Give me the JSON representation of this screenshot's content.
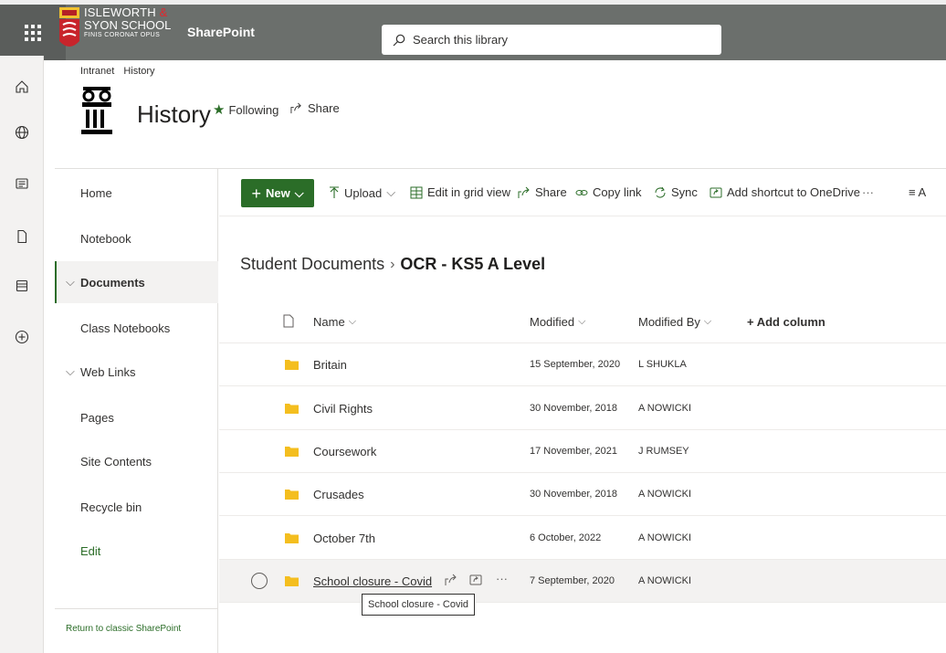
{
  "suitebar": {
    "school_line1": "ISLEWORTH",
    "school_amp": "&",
    "school_line2": "SYON SCHOOL",
    "school_motto": "FINIS CORONAT OPUS",
    "brand": "SharePoint",
    "search_placeholder": "Search this library",
    "bg_color": "#6b6f6c"
  },
  "site": {
    "breadcrumb": [
      "Intranet",
      "History"
    ],
    "title": "History",
    "following_label": "Following",
    "share_label": "Share"
  },
  "leftnav": {
    "items": [
      {
        "label": "Home"
      },
      {
        "label": "Notebook"
      },
      {
        "label": "Documents"
      },
      {
        "label": "Class Notebooks"
      },
      {
        "label": "Web Links"
      },
      {
        "label": "Pages"
      },
      {
        "label": "Site Contents"
      },
      {
        "label": "Recycle bin"
      },
      {
        "label": "Edit"
      }
    ],
    "classic_link": "Return to classic SharePoint"
  },
  "commandbar": {
    "new_label": "New",
    "upload_label": "Upload",
    "grid_label": "Edit in grid view",
    "share_label": "Share",
    "copylink_label": "Copy link",
    "sync_label": "Sync",
    "shortcut_label": "Add shortcut to OneDrive",
    "more_label": "···",
    "view_label": "≡ A",
    "accent_color": "#2b6d28"
  },
  "library": {
    "breadcrumb_parent": "Student Documents",
    "breadcrumb_current": "OCR - KS5 A Level",
    "columns": {
      "name": "Name",
      "modified": "Modified",
      "modified_by": "Modified By",
      "add_column": "+ Add column"
    },
    "rows": [
      {
        "name": "Britain",
        "modified": "15 September, 2020",
        "modified_by": "L SHUKLA"
      },
      {
        "name": "Civil Rights",
        "modified": "30 November, 2018",
        "modified_by": "A NOWICKI"
      },
      {
        "name": "Coursework",
        "modified": "17 November, 2021",
        "modified_by": "J RUMSEY"
      },
      {
        "name": "Crusades",
        "modified": "30 November, 2018",
        "modified_by": "A NOWICKI"
      },
      {
        "name": "October 7th",
        "modified": "6 October, 2022",
        "modified_by": "A NOWICKI"
      },
      {
        "name": "School closure - Covid",
        "modified": "7 September, 2020",
        "modified_by": "A NOWICKI"
      }
    ],
    "tooltip": "School closure - Covid",
    "row_more": "···"
  }
}
